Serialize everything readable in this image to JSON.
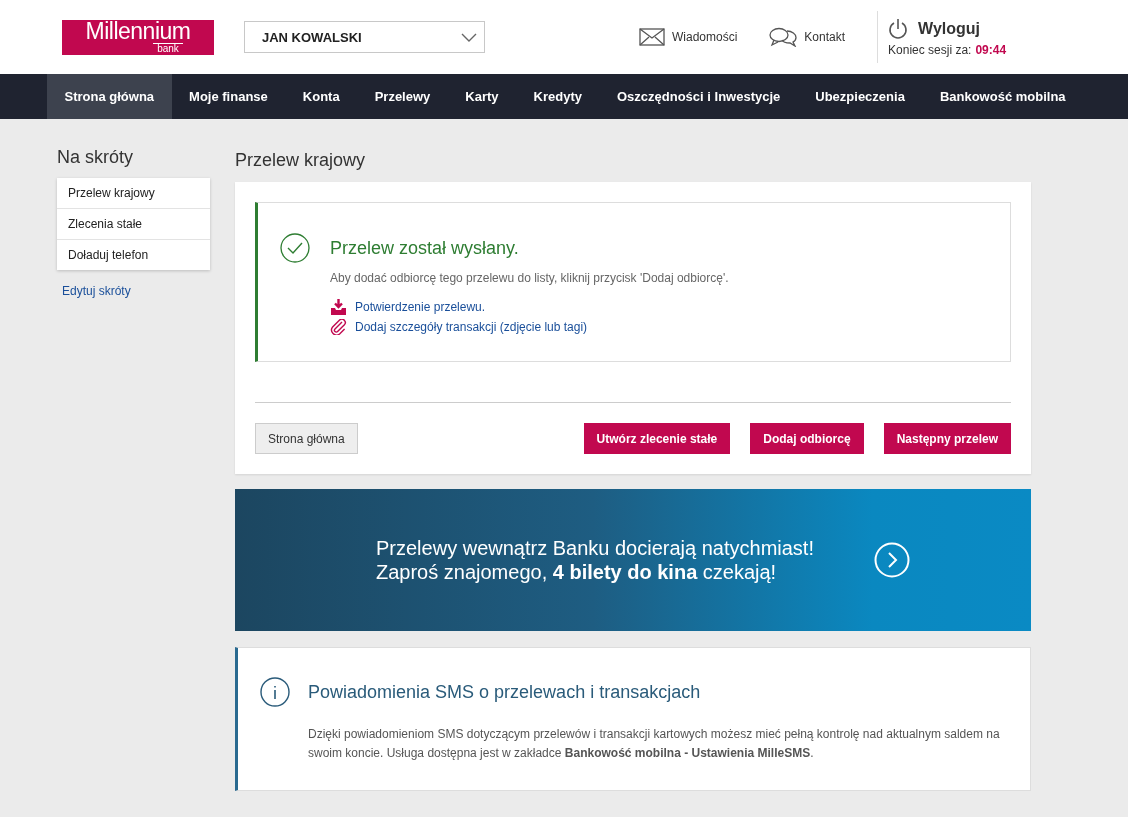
{
  "header": {
    "logo": {
      "name": "Millennium",
      "sub": "bank"
    },
    "account_selector": {
      "value": "JAN KOWALSKI"
    },
    "links": [
      {
        "kind": "messages",
        "label": "Wiadomości"
      },
      {
        "kind": "contact",
        "label": "Kontakt"
      }
    ],
    "logout": {
      "label": "Wyloguj",
      "session_label": "Koniec sesji za:",
      "session_time": "09:44"
    }
  },
  "nav": [
    {
      "label": "Strona główna",
      "selected": true
    },
    {
      "label": "Moje finanse",
      "selected": false
    },
    {
      "label": "Konta",
      "selected": false
    },
    {
      "label": "Przelewy",
      "selected": false
    },
    {
      "label": "Karty",
      "selected": false
    },
    {
      "label": "Kredyty",
      "selected": false
    },
    {
      "label": "Oszczędności i Inwestycje",
      "selected": false
    },
    {
      "label": "Ubezpieczenia",
      "selected": false
    },
    {
      "label": "Bankowość mobilna",
      "selected": false
    }
  ],
  "shortcuts": {
    "title": "Na skróty",
    "items": [
      "Przelew krajowy",
      "Zlecenia stałe",
      "Doładuj telefon"
    ],
    "edit_link": "Edytuj skróty"
  },
  "page_title": "Przelew krajowy",
  "confirmation": {
    "title": "Przelew został wysłany.",
    "message": "Aby dodać odbiorcę tego przelewu do listy, kliknij przycisk 'Dodaj odbiorcę'.",
    "links": [
      {
        "kind": "download",
        "label": "Potwierdzenie przelewu."
      },
      {
        "kind": "attach",
        "label": "Dodaj szczegóły transakcji (zdjęcie lub tagi)"
      }
    ]
  },
  "actions": {
    "secondary": "Strona główna",
    "primary": [
      "Utwórz zlecenie stałe",
      "Dodaj odbiorcę",
      "Następny przelew"
    ]
  },
  "banner": {
    "line_1": "Przelewy wewnątrz Banku docierają natychmiast!",
    "line_2": "Zaproś znajomego, **4 bilety do kina** czekają!"
  },
  "info": {
    "title": "Powiadomienia SMS o przelewach i transakcjach",
    "text": "Dzięki powiadomieniom SMS dotyczącym przelewów i transakcji kartowych możesz mieć pełną kontrolę nad aktualnym saldem na swoim koncie. Usługa dostępna jest w zakładce **Bankowość mobilna - Ustawienia MilleSMS**."
  }
}
